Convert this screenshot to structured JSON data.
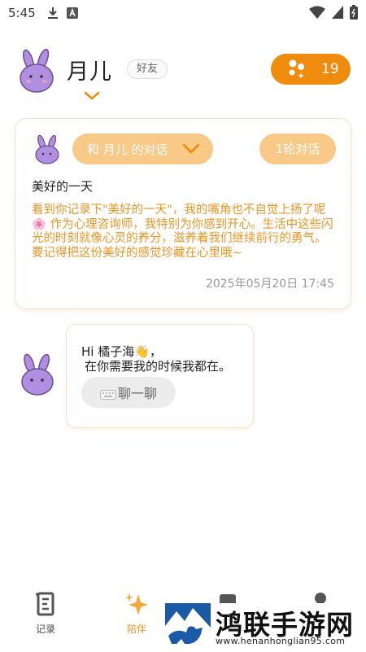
{
  "status_bar": {
    "time": "5:45",
    "icons": [
      "download-icon",
      "font-icon",
      "wifi-icon",
      "signal-icon",
      "battery-icon"
    ]
  },
  "header": {
    "character_name": "月儿",
    "relationship_badge": "好友",
    "points": "19"
  },
  "diary_card": {
    "conversation_label": "和 月儿 的对话",
    "rounds_label": "1轮对话",
    "entry_title": "美好的一天",
    "reply_text": "看到你记录下\"美好的一天\"，我的嘴角也不自觉上扬了呢 🌸 作为心理咨询师，我特别为你感到开心。生活中这些闪光的时刻就像心灵的养分，滋养着我们继续前行的勇气。要记得把这份美好的感觉珍藏在心里哦~",
    "timestamp": "2025年05月20日 17:45"
  },
  "greeting": {
    "line1": "Hi 橘子海👋，",
    "line2": "在你需要我的时候我都在。",
    "chat_button": "聊一聊"
  },
  "bottom_nav": {
    "items": [
      {
        "label": "记录",
        "icon": "journal-icon",
        "active": false
      },
      {
        "label": "陪伴",
        "icon": "sparkle-icon",
        "active": true
      }
    ]
  },
  "watermark": {
    "title": "鸿联手游网",
    "url": "www.henanhonglian95.com"
  },
  "colors": {
    "accent": "#f08c0d",
    "accent_light": "#f9c988",
    "reply_text": "#ef9421",
    "avatar_purple": "#b08fe0"
  }
}
